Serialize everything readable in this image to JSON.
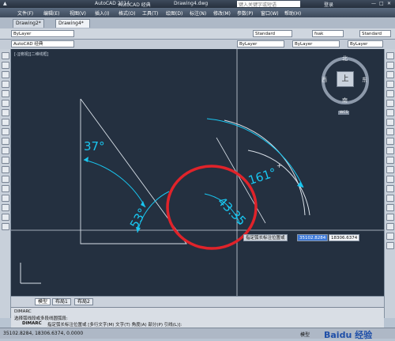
{
  "titlebar": {
    "app_name": "AutoCAD 经典",
    "app_version": "AutoCAD 2014",
    "doc_name": "Drawing4.dwg",
    "search_placeholder": "键入关键字或短语",
    "login": "登录"
  },
  "menu": [
    "文件(F)",
    "编辑(E)",
    "视图(V)",
    "插入(I)",
    "格式(O)",
    "工具(T)",
    "绘图(D)",
    "标注(N)",
    "修改(M)",
    "参数(P)",
    "窗口(W)",
    "帮助(H)"
  ],
  "doc_tabs": [
    "Drawing2*",
    "Drawing4*"
  ],
  "props": {
    "workspace": "AutoCAD 经典",
    "layer": "ByLayer",
    "text_style": "Standard",
    "linetype": "ByLayer",
    "dim_style": "Standard",
    "table_style": "Standard",
    "color": "ByLayer",
    "lineweight": "ByLayer",
    "font": "fsak",
    "plot_style": "ByColor"
  },
  "viewport_label": "[-][俯视][二维线框]",
  "viewcube": {
    "north": "北",
    "south": "南",
    "west": "西",
    "east": "东",
    "top": "上",
    "wcs": "WCS"
  },
  "dimensions": {
    "angle_37": "37°",
    "angle_53": "53°",
    "angle_161": "161°",
    "arc_length": "43.35"
  },
  "dynamic_input": {
    "prompt": "指定弧长标注位置或",
    "x_value": "35102.8284",
    "y_value": "18306.6374"
  },
  "layout_tabs": [
    "模型",
    "布局1",
    "布局2"
  ],
  "command": {
    "history_1": "DIMARC",
    "history_2": "选择弧线段或多段线圆弧段:",
    "prompt_cmd": "DIMARC",
    "prompt_text": "指定弧长标注位置或 [多行文字(M) 文字(T) 角度(A) 部分(P) 引线(L)]:"
  },
  "status": {
    "coords": "35102.8284, 18306.6374, 0.0000",
    "model": "模型"
  },
  "watermark": "Baidu 经验",
  "colors": {
    "canvas": "#243040",
    "dim": "#19c6f0",
    "highlight": "#e0232a"
  }
}
